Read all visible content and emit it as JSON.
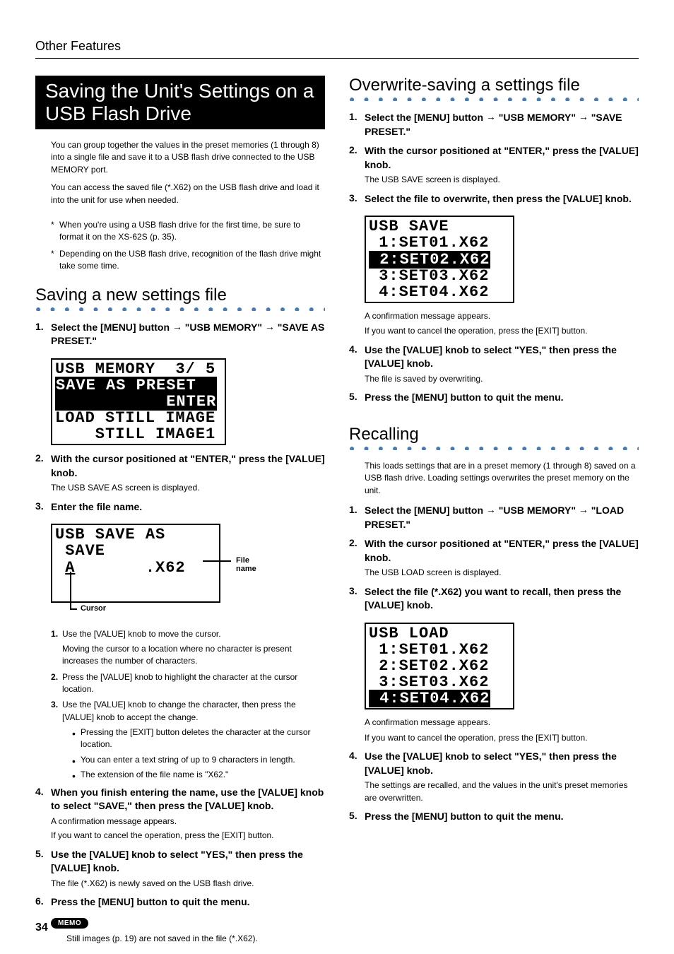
{
  "header": {
    "section": "Other Features"
  },
  "page_number": "34",
  "left": {
    "title": "Saving the Unit's Settings on a USB Flash Drive",
    "intro1": "You can group together the values in the preset memories (1 through 8) into a single file and save it to a USB flash drive connected to the USB MEMORY port.",
    "intro2": "You can access the saved file (*.X62) on the USB flash drive and load it into the unit for use when needed.",
    "star1": "When you're using a USB flash drive for the first time, be sure to format it on the XS-62S (p. 35).",
    "star2": "Depending on the USB flash drive, recognition of the flash drive might take some time.",
    "saving_new": {
      "title": "Saving a new settings file",
      "step1_a": "Select the [MENU] button",
      "step1_b": "\"USB MEMORY\"",
      "step1_c": "\"SAVE AS PRESET.\"",
      "lcd1_l1": "USB MEMORY  3/ 5",
      "lcd1_l2": "SAVE AS PRESET  ",
      "lcd1_l3": "           ENTER",
      "lcd1_l4": "LOAD STILL IMAGE",
      "lcd1_l5": "    STILL IMAGE1",
      "step2": "With the cursor positioned at \"ENTER,\" press the [VALUE] knob.",
      "step2_sub": "The USB SAVE AS screen is displayed.",
      "step3": "Enter the file name.",
      "lcd2_l1": "USB SAVE AS",
      "lcd2_l2": " SAVE",
      "lcd2_l3_a": " ",
      "lcd2_l3_b": "A",
      "lcd2_l3_c": "       .X62",
      "callout_file": "File name",
      "callout_cursor": "Cursor",
      "sub1": "Use the [VALUE] knob to move the cursor.",
      "sub1_text": "Moving the cursor to a location where no character is present increases the number of characters.",
      "sub2": "Press the [VALUE] knob to highlight the character at the cursor location.",
      "sub3": "Use the [VALUE] knob to change the character, then press the [VALUE] knob to accept the change.",
      "sub3_b1": "Pressing the [EXIT] button deletes the character at the cursor location.",
      "sub3_b2": "You can enter a text string of up to 9 characters in length.",
      "sub3_b3": "The extension of the file name is \"X62.\"",
      "step4": "When you finish entering the name, use the [VALUE] knob to select \"SAVE,\" then press the [VALUE] knob.",
      "step4_sub1": "A confirmation message appears.",
      "step4_sub2": "If you want to cancel the operation, press the [EXIT] button.",
      "step5": "Use the [VALUE] knob to select \"YES,\" then press the [VALUE] knob.",
      "step5_sub": "The file (*.X62) is newly saved on the USB flash drive.",
      "step6": "Press the [MENU] button to quit the menu.",
      "memo_label": "MEMO",
      "memo_text": "Still images (p. 19) are not saved in the file (*.X62)."
    }
  },
  "right": {
    "overwrite": {
      "title": "Overwrite-saving a settings file",
      "step1_a": "Select the [MENU] button",
      "step1_b": "\"USB MEMORY\"",
      "step1_c": "\"SAVE PRESET.\"",
      "step2": "With the cursor positioned at \"ENTER,\" press the [VALUE] knob.",
      "step2_sub": "The USB SAVE screen is displayed.",
      "step3": "Select the file to overwrite, then press the [VALUE] knob.",
      "lcd_l1": "USB SAVE",
      "lcd_l2": " 1:SET01.X62",
      "lcd_l3": " 2:SET02.X62",
      "lcd_l4": " 3:SET03.X62",
      "lcd_l5": " 4:SET04.X62",
      "step3_sub1": "A confirmation message appears.",
      "step3_sub2": "If you want to cancel the operation, press the [EXIT] button.",
      "step4": "Use the [VALUE] knob to select \"YES,\" then press the [VALUE] knob.",
      "step4_sub": "The file is saved by overwriting.",
      "step5": "Press the [MENU] button to quit the menu."
    },
    "recalling": {
      "title": "Recalling",
      "intro": "This loads settings that are in a preset memory (1 through 8) saved on a USB flash drive. Loading settings overwrites the preset memory on the unit.",
      "step1_a": "Select the [MENU] button",
      "step1_b": "\"USB MEMORY\"",
      "step1_c": "\"LOAD PRESET.\"",
      "step2": "With the cursor positioned at \"ENTER,\" press the [VALUE] knob.",
      "step2_sub": "The USB LOAD screen is displayed.",
      "step3": "Select the file (*.X62) you want to recall, then press the [VALUE] knob.",
      "lcd_l1": "USB LOAD",
      "lcd_l2": " 1:SET01.X62",
      "lcd_l3": " 2:SET02.X62",
      "lcd_l4": " 3:SET03.X62",
      "lcd_l5": " 4:SET04.X62",
      "step3_sub1": "A confirmation message appears.",
      "step3_sub2": "If you want to cancel the operation, press the [EXIT] button.",
      "step4": "Use the [VALUE] knob to select \"YES,\" then press the [VALUE] knob.",
      "step4_sub": "The settings are recalled, and the values in the unit's preset memories are overwritten.",
      "step5": "Press the [MENU] button to quit the menu."
    }
  }
}
